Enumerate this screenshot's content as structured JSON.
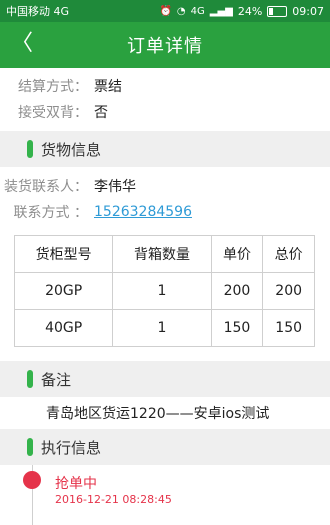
{
  "status_bar": {
    "carrier": "中国移动 4G",
    "network": "4G",
    "battery": "24%",
    "time": "09:07"
  },
  "header": {
    "title": "订单详情"
  },
  "settlement": [
    {
      "label": "结算方式：",
      "value": "票结"
    },
    {
      "label": "接受双背：",
      "value": "否"
    }
  ],
  "cargo": {
    "section_title": "货物信息",
    "contact_label": "装货联系人：",
    "contact_name": "李伟华",
    "phone_label": "联系方式 ：",
    "phone": "15263284596",
    "table": {
      "headers": [
        "货柜型号",
        "背箱数量",
        "单价",
        "总价"
      ],
      "rows": [
        [
          "20GP",
          "1",
          "200",
          "200"
        ],
        [
          "40GP",
          "1",
          "150",
          "150"
        ]
      ]
    }
  },
  "remark": {
    "section_title": "备注",
    "text": "青岛地区货运1220——安卓ios测试"
  },
  "execution": {
    "section_title": "执行信息",
    "state": "抢单中",
    "time": "2016-12-21 08:28:45",
    "accent": "#e5334a"
  },
  "colors": {
    "statusbar": "#1f8a3a",
    "appbar": "#2aa13f",
    "accent_green": "#34b34b",
    "link": "#2f9bd6"
  }
}
